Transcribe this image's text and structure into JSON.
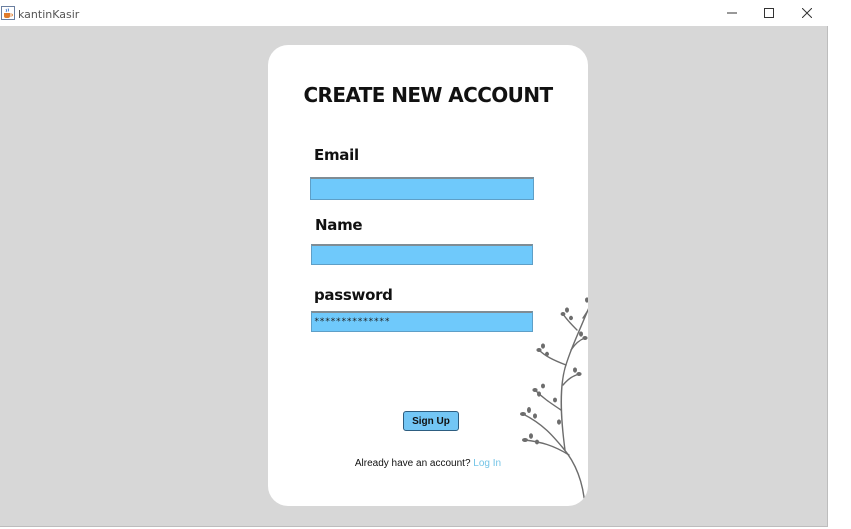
{
  "window": {
    "title": "kantinKasir",
    "icons": {
      "app": "java-cup-icon",
      "minimize": "minimize-icon",
      "maximize": "maximize-icon",
      "close": "close-icon"
    }
  },
  "form": {
    "heading": "CREATE NEW ACCOUNT",
    "email_label": "Email",
    "email_value": "",
    "name_label": "Name",
    "name_value": "",
    "password_label": "password",
    "password_value": "**************",
    "signup_button": "Sign Up",
    "login_prompt": "Already have an account?",
    "login_link": "Log In"
  },
  "colors": {
    "background": "#d7d7d7",
    "card": "#ffffff",
    "field": "#6fc9fb",
    "button": "#73c6f5",
    "link": "#74c4e6"
  }
}
